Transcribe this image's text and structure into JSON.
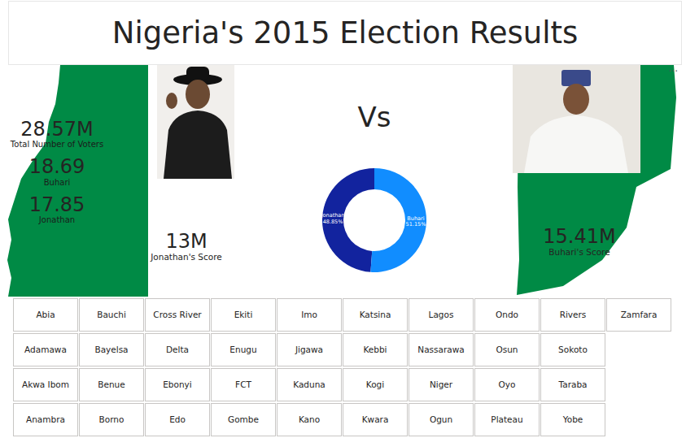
{
  "title": "Nigeria's 2015 Election Results",
  "stats": [
    {
      "value": "28.57M",
      "label": "Total Number of Voters"
    },
    {
      "value": "18.69",
      "label": "Buhari"
    },
    {
      "value": "17.85",
      "label": "Jonathan"
    }
  ],
  "jonathan": {
    "score": "13M",
    "label": "Jonathan's Score"
  },
  "buhari": {
    "score": "15.41M",
    "label": "Buhari's Score"
  },
  "versus": "Vs",
  "menu": "···",
  "donut": {
    "slices": [
      {
        "name": "Jonathan",
        "percent": "48.85%",
        "value": 48.85,
        "color": "#12239e"
      },
      {
        "name": "Buhari",
        "percent": "51.15%",
        "value": 51.15,
        "color": "#118dff"
      }
    ]
  },
  "states": [
    [
      {
        "label": "Abia",
        "selected": false
      },
      {
        "label": "Bauchi",
        "selected": false
      },
      {
        "label": "Cross River",
        "selected": false
      },
      {
        "label": "Ekiti",
        "selected": false
      },
      {
        "label": "Imo",
        "selected": false
      },
      {
        "label": "Katsina",
        "selected": false
      },
      {
        "label": "Lagos",
        "selected": false
      },
      {
        "label": "Ondo",
        "selected": false
      },
      {
        "label": "Rivers",
        "selected": false
      },
      {
        "label": "Zamfara",
        "selected": false
      }
    ],
    [
      {
        "label": "Adamawa",
        "selected": false
      },
      {
        "label": "Bayelsa",
        "selected": false
      },
      {
        "label": "Delta",
        "selected": false
      },
      {
        "label": "Enugu",
        "selected": false
      },
      {
        "label": "Jigawa",
        "selected": false
      },
      {
        "label": "Kebbi",
        "selected": false
      },
      {
        "label": "Nassarawa",
        "selected": false
      },
      {
        "label": "Osun",
        "selected": false
      },
      {
        "label": "Sokoto",
        "selected": false
      }
    ],
    [
      {
        "label": "Akwa Ibom",
        "selected": false
      },
      {
        "label": "Benue",
        "selected": false
      },
      {
        "label": "Ebonyi",
        "selected": false
      },
      {
        "label": "FCT",
        "selected": false
      },
      {
        "label": "Kaduna",
        "selected": false
      },
      {
        "label": "Kogi",
        "selected": false
      },
      {
        "label": "Niger",
        "selected": false
      },
      {
        "label": "Oyo",
        "selected": false
      },
      {
        "label": "Taraba",
        "selected": false
      }
    ],
    [
      {
        "label": "Anambra",
        "selected": false
      },
      {
        "label": "Borno",
        "selected": false
      },
      {
        "label": "Edo",
        "selected": false
      },
      {
        "label": "Gombe",
        "selected": false
      },
      {
        "label": "Kano",
        "selected": false
      },
      {
        "label": "Kwara",
        "selected": false
      },
      {
        "label": "Ogun",
        "selected": false
      },
      {
        "label": "Plateau",
        "selected": false
      },
      {
        "label": "Yobe",
        "selected": false
      }
    ]
  ]
}
